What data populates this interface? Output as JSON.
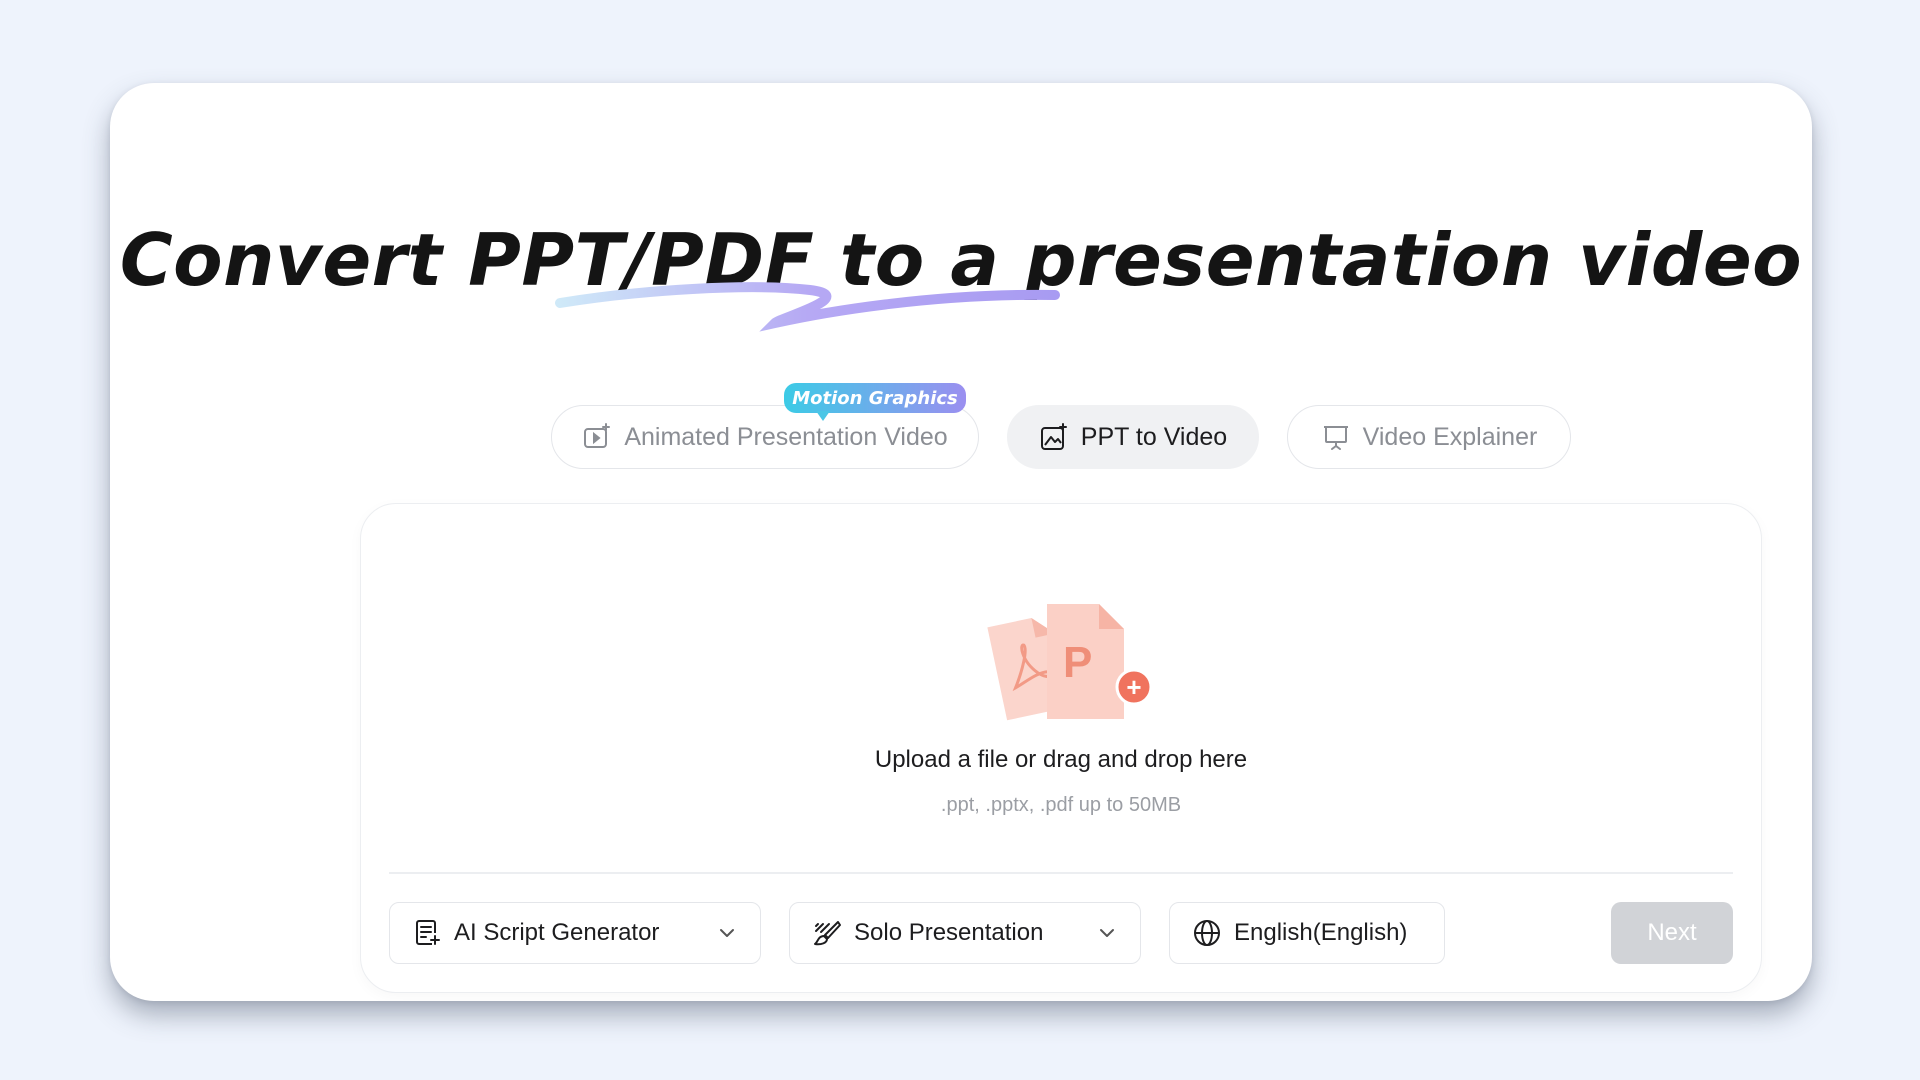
{
  "headline": "Convert PPT/PDF to a presentation video",
  "badge": "Motion Graphics",
  "tabs": [
    {
      "label": "Animated Presentation Video",
      "active": false,
      "icon": "video-sparkle-icon"
    },
    {
      "label": "PPT to Video",
      "active": true,
      "icon": "image-sparkle-icon"
    },
    {
      "label": "Video Explainer",
      "active": false,
      "icon": "presentation-board-icon"
    }
  ],
  "upload": {
    "title": "Upload a file or drag and drop here",
    "subtitle": ".ppt, .pptx, .pdf up to 50MB",
    "icons": [
      "pdf-file-icon",
      "ppt-file-icon",
      "add-circle-icon"
    ],
    "ppt_letter": "P",
    "add_symbol": "+"
  },
  "controls": {
    "script": {
      "label": "AI Script Generator",
      "icon": "script-icon"
    },
    "mode": {
      "label": "Solo Presentation",
      "icon": "brush-icon"
    },
    "language": {
      "label": "English(English)",
      "icon": "globe-icon"
    },
    "next_label": "Next",
    "next_enabled": false
  },
  "colors": {
    "page_bg": "#eef3fc",
    "badge_gradient_start": "#3ccbe6",
    "badge_gradient_end": "#9b8ff0",
    "file_icon": "#f4a89a",
    "next_disabled": "#d1d3d7"
  }
}
